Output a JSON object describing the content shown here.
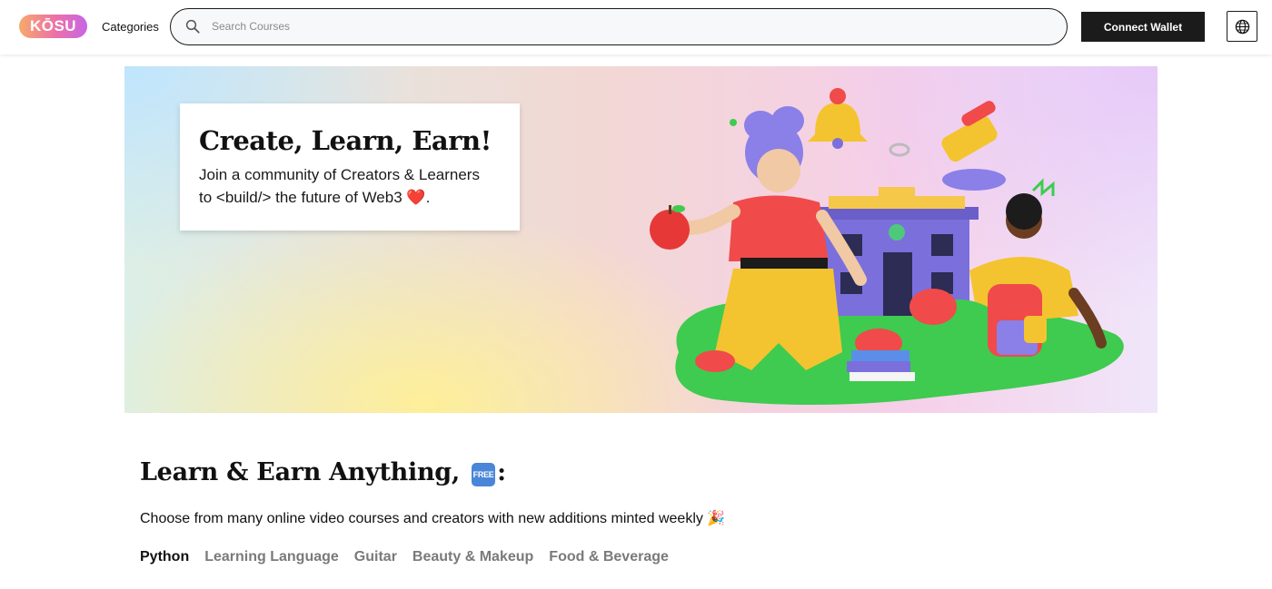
{
  "header": {
    "logo_text": "KŌSU",
    "categories_label": "Categories",
    "search_placeholder": "Search Courses",
    "connect_wallet_label": "Connect Wallet",
    "language_icon": "globe-icon"
  },
  "hero": {
    "title": "Create, Learn, Earn!",
    "subtitle_line1": "Join a community of Creators & Learners",
    "subtitle_line2": "to <build/> the future of Web3 ❤️."
  },
  "section": {
    "title_prefix": "Learn & Earn Anything,",
    "free_badge": "FREE",
    "title_suffix": ":",
    "subtitle": "Choose from many online video courses and creators with new additions minted weekly 🎉",
    "tabs": [
      {
        "label": "Python",
        "active": true
      },
      {
        "label": "Learning Language",
        "active": false
      },
      {
        "label": "Guitar",
        "active": false
      },
      {
        "label": "Beauty & Makeup",
        "active": false
      },
      {
        "label": "Food & Beverage",
        "active": false
      }
    ]
  },
  "colors": {
    "logo_gradient_start": "#f7a96b",
    "logo_gradient_end": "#c667e6",
    "button_dark": "#1b1b1b",
    "tab_inactive": "#7a7a7a",
    "tab_active": "#111111"
  }
}
